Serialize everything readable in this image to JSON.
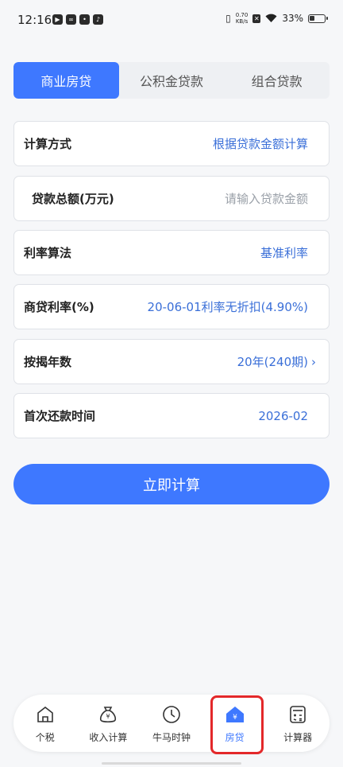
{
  "status_bar": {
    "time": "12:16",
    "speed_top": "0.70",
    "speed_bottom": "KB/s",
    "battery": "33%"
  },
  "tabs": [
    {
      "label": "商业房贷",
      "active": true
    },
    {
      "label": "公积金贷款",
      "active": false
    },
    {
      "label": "组合贷款",
      "active": false
    }
  ],
  "form": {
    "calc_method": {
      "label": "计算方式",
      "value": "根据贷款金额计算"
    },
    "loan_amount": {
      "label": "贷款总额(万元)",
      "placeholder": "请输入贷款金额",
      "value": ""
    },
    "rate_method": {
      "label": "利率算法",
      "value": "基准利率"
    },
    "rate": {
      "label": "商贷利率(%)",
      "value": "20-06-01利率无折扣(4.90%)"
    },
    "years": {
      "label": "按揭年数",
      "value": "20年(240期)",
      "chevron": "›"
    },
    "first_payment": {
      "label": "首次还款时间",
      "value": "2026-02"
    }
  },
  "calculate_button": "立即计算",
  "bottom_nav": [
    {
      "label": "个税",
      "icon": "house-icon"
    },
    {
      "label": "收入计算",
      "icon": "money-bag-icon"
    },
    {
      "label": "牛马时钟",
      "icon": "clock-icon"
    },
    {
      "label": "房贷",
      "icon": "house-yuan-icon",
      "active": true
    },
    {
      "label": "计算器",
      "icon": "calculator-icon"
    }
  ],
  "colors": {
    "accent": "#3e78ff",
    "value_text": "#3a6fd8",
    "highlight": "#e3282a"
  }
}
